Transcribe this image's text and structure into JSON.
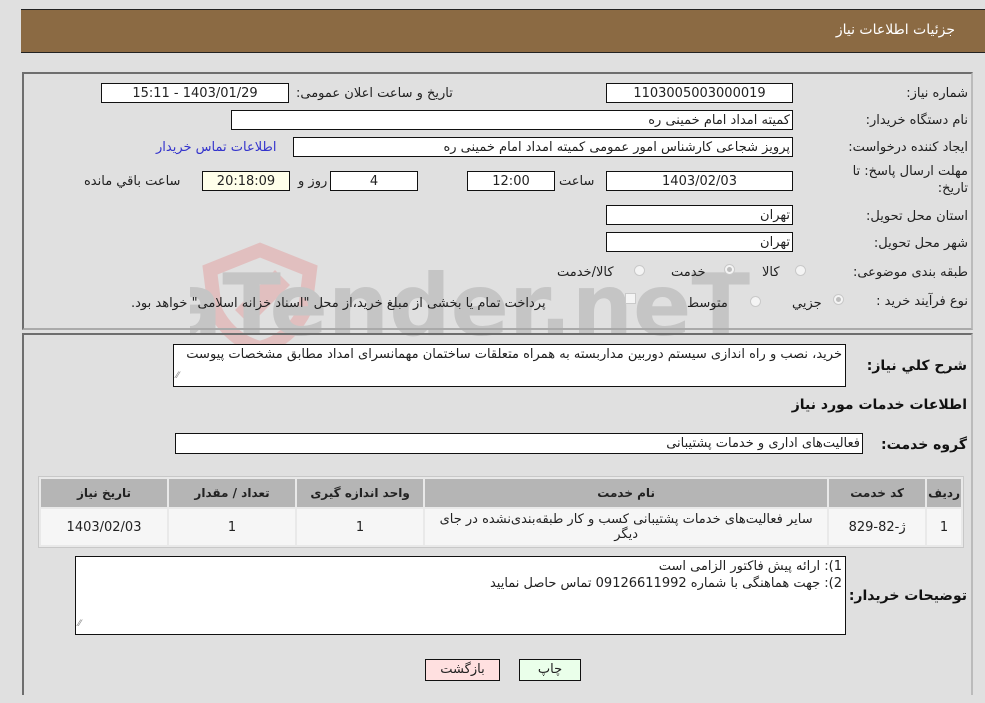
{
  "header": {
    "title": "جزئیات اطلاعات نیاز"
  },
  "form": {
    "need_number": {
      "label": "شماره نیاز:",
      "value": "1103005003000019"
    },
    "announce_datetime": {
      "label": "تاریخ و ساعت اعلان عمومی:",
      "value": "1403/01/29 - 15:11"
    },
    "buyer_org": {
      "label": "نام دستگاه خریدار:",
      "value": "کمیته امداد امام خمینی ره"
    },
    "requester": {
      "label": "ایجاد کننده درخواست:",
      "value": "پرویز شجاعی کارشناس امور عمومی کمیته امداد امام خمینی ره",
      "contact_link": "اطلاعات تماس خریدار"
    },
    "deadline": {
      "label_line1": "مهلت ارسال پاسخ: تا",
      "label_line2": "تاریخ:",
      "date": "1403/02/03",
      "time_label": "ساعت",
      "time": "12:00",
      "days": "4",
      "days_label": "روز و",
      "remaining": "20:18:09",
      "remaining_label": "ساعت باقي مانده"
    },
    "province": {
      "label": "استان محل تحویل:",
      "value": "تهران"
    },
    "city": {
      "label": "شهر محل تحویل:",
      "value": "تهران"
    },
    "category": {
      "label": "طبقه بندی موضوعی:",
      "options": [
        {
          "label": "کالا",
          "selected": false
        },
        {
          "label": "خدمت",
          "selected": true
        },
        {
          "label": "کالا/خدمت",
          "selected": false
        }
      ]
    },
    "purchase_type": {
      "label": "نوع فرآیند خرید :",
      "options": [
        {
          "label": "جزيي",
          "selected": true
        },
        {
          "label": "متوسط",
          "selected": false
        }
      ],
      "treasury_checkbox_label": "پرداخت تمام یا بخشی از مبلغ خرید،از محل \"اسناد خزانه اسلامی\" خواهد بود.",
      "treasury_checked": false
    }
  },
  "description": {
    "label": "شرح کلي نياز:",
    "value": "خرید، نصب و راه اندازی سیستم دوربین مداربسته به همراه متعلقات ساختمان مهمانسرای امداد مطابق مشخصات پیوست"
  },
  "services_section": {
    "title": "اطلاعات خدمات مورد نیاز",
    "group_label": "گروه خدمت:",
    "group_value": "فعالیت‌های اداری و خدمات پشتیبانی",
    "table": {
      "headers": [
        "ردیف",
        "کد خدمت",
        "نام خدمت",
        "واحد اندازه گیری",
        "تعداد / مقدار",
        "تاریخ نیاز"
      ],
      "rows": [
        [
          "1",
          "ژ-82-829",
          "سایر فعالیت‌های خدمات پشتیبانی کسب و کار طبقه‌بندی‌نشده در جای دیگر",
          "1",
          "1",
          "1403/02/03"
        ]
      ]
    }
  },
  "buyer_notes": {
    "label": "توضیحات خریدار:",
    "lines": [
      "1): ارائه پیش فاکتور الزامی است",
      "2): جهت هماهنگی با شماره 09126611992 تماس حاصل نمایید"
    ]
  },
  "buttons": {
    "print": "چاپ",
    "back": "بازگشت"
  },
  "colors": {
    "header_bg": "#8b6a43",
    "print_bg": "#eaffea",
    "back_bg": "#ffe0e0",
    "link": "#3333cc"
  }
}
